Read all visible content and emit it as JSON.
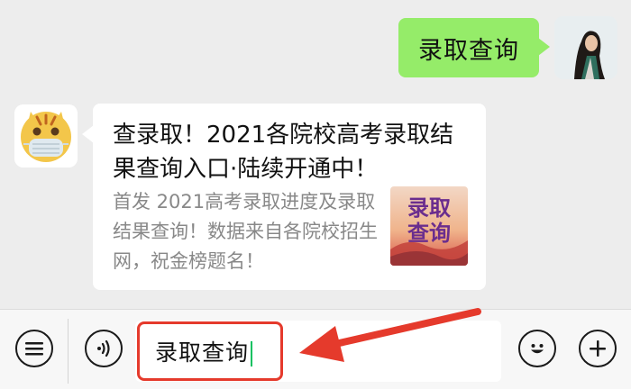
{
  "chat": {
    "outgoing_message": "录取查询",
    "card": {
      "title": "查录取！2021各院校高考录取结果查询入口·陆续开通中！",
      "description": "首发 2021高考录取进度及录取结果查询！数据来自各院校招生网，祝金榜题名！",
      "thumbnail_line1": "录取",
      "thumbnail_line2": "查询"
    }
  },
  "input_bar": {
    "value": "录取查询",
    "menu_icon": "menu-list-icon",
    "voice_icon": "voice-icon",
    "emoji_icon": "emoji-icon",
    "plus_icon": "plus-icon"
  },
  "colors": {
    "outgoing_bubble": "#95ec69",
    "highlight": "#e53a2c",
    "cursor": "#07c160"
  }
}
